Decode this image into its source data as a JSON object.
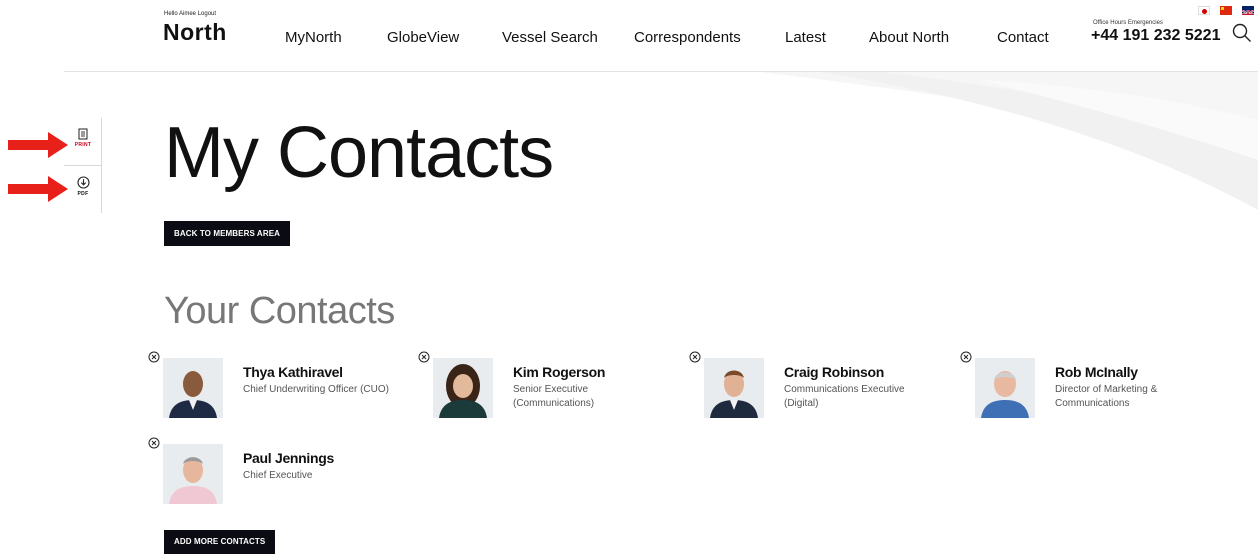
{
  "header": {
    "greeting": "Hello Aimee",
    "logout_label": "Logout",
    "logo_text": "North",
    "nav": [
      {
        "label": "MyNorth"
      },
      {
        "label": "GlobeView"
      },
      {
        "label": "Vessel Search"
      },
      {
        "label": "Correspondents"
      },
      {
        "label": "Latest"
      },
      {
        "label": "About North"
      },
      {
        "label": "Contact"
      }
    ],
    "office_hours_label": "Office Hours Emergencies",
    "phone": "+44 191 232 5221",
    "languages": [
      "japanese-flag-icon",
      "chinese-flag-icon",
      "uk-flag-icon"
    ],
    "search_icon": "search-icon"
  },
  "tools": {
    "print_label": "PRINT",
    "pdf_label": "PDF"
  },
  "page": {
    "title": "My Contacts",
    "back_button": "BACK TO MEMBERS AREA",
    "section_title": "Your Contacts",
    "add_button": "ADD MORE CONTACTS"
  },
  "contacts": [
    {
      "name": "Thya Kathiravel",
      "role": "Chief Underwriting Officer (CUO)"
    },
    {
      "name": "Kim Rogerson",
      "role": "Senior Executive (Communications)"
    },
    {
      "name": "Craig Robinson",
      "role": "Communications Executive (Digital)"
    },
    {
      "name": "Rob McInally",
      "role": "Director of Marketing & Communications"
    },
    {
      "name": "Paul Jennings",
      "role": "Chief Executive"
    }
  ],
  "colors": {
    "accent_red": "#d0021b",
    "button_dark": "#0b0b14",
    "annotation_arrow": "#e8201a"
  }
}
